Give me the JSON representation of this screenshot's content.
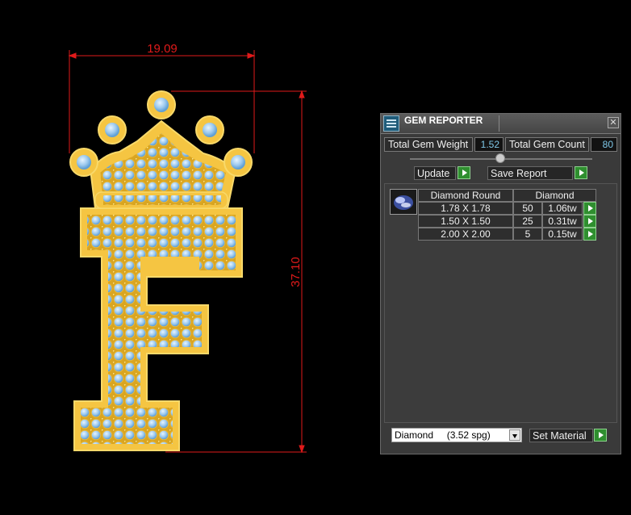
{
  "drawing": {
    "width_dimension": "19.09",
    "height_dimension": "37.10",
    "colors": {
      "dimension": "#e01a1a",
      "gold": "#f5c542",
      "gem": "#9cc9ee"
    }
  },
  "panel": {
    "title": "GEM REPORTER",
    "close_glyph": "✕",
    "total_gem_weight_label": "Total Gem Weight",
    "total_gem_weight_value": "1.52",
    "total_gem_count_label": "Total Gem Count",
    "total_gem_count_value": "80",
    "update_label": "Update",
    "save_report_label": "Save Report",
    "table": {
      "headers": [
        "Diamond Round",
        "Diamond"
      ],
      "rows": [
        {
          "size": "1.78 X 1.78",
          "count": "50",
          "weight": "1.06tw"
        },
        {
          "size": "1.50 X 1.50",
          "count": "25",
          "weight": "0.31tw"
        },
        {
          "size": "2.00 X 2.00",
          "count": "5",
          "weight": "0.15tw"
        }
      ]
    },
    "material_select": "Diamond     (3.52 spg)",
    "set_material_label": "Set Material"
  }
}
